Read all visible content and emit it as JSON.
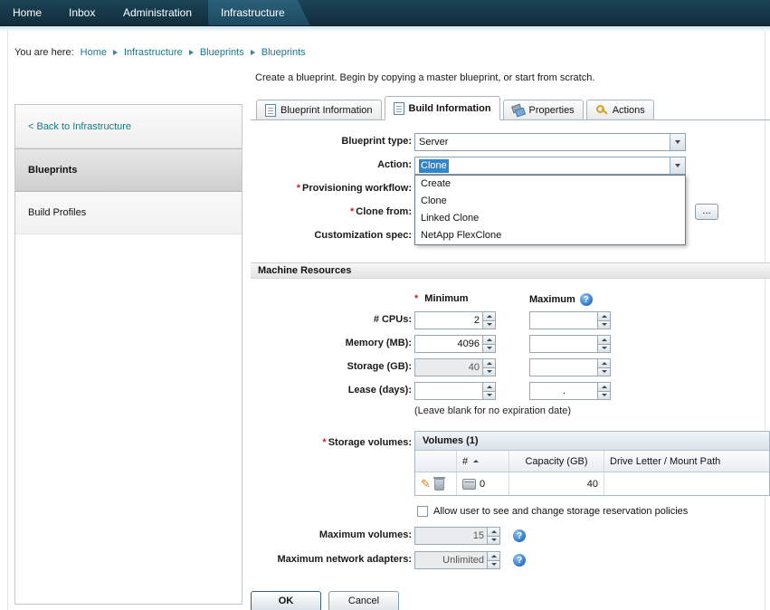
{
  "colors": {
    "topnav_bg": "#15374a",
    "link_teal": "#17788c",
    "selection_blue": "#2f86c8",
    "required_red": "#cc2222",
    "help_blue": "#2a6fc0"
  },
  "icons": {
    "pencil": "✎",
    "help_glyph": "?"
  },
  "topnav": {
    "items": [
      {
        "label": "Home",
        "active": false
      },
      {
        "label": "Inbox",
        "active": false
      },
      {
        "label": "Administration",
        "active": false
      },
      {
        "label": "Infrastructure",
        "active": true
      }
    ]
  },
  "breadcrumb": {
    "prefix": "You are here:",
    "links": [
      "Home",
      "Infrastructure",
      "Blueprints"
    ],
    "current": "Blueprints"
  },
  "intro": "Create a blueprint. Begin by copying a master blueprint, or start from scratch.",
  "sidebar": {
    "back": "< Back to Infrastructure",
    "items": [
      {
        "label": "Blueprints",
        "selected": true
      },
      {
        "label": "Build Profiles",
        "selected": false
      }
    ]
  },
  "tabs": [
    {
      "label": "Blueprint Information",
      "active": false
    },
    {
      "label": "Build Information",
      "active": true
    },
    {
      "label": "Properties",
      "active": false
    },
    {
      "label": "Actions",
      "active": false
    }
  ],
  "form": {
    "blueprint_type": {
      "label": "Blueprint type:",
      "value": "Server"
    },
    "action": {
      "label": "Action:",
      "value": "Clone",
      "options": [
        "Create",
        "Clone",
        "Linked Clone",
        "NetApp FlexClone"
      ]
    },
    "provisioning_workflow": {
      "label": "Provisioning workflow:",
      "required": true
    },
    "clone_from": {
      "label": "Clone from:",
      "required": true,
      "browse_label": "..."
    },
    "customization_spec": {
      "label": "Customization spec:"
    }
  },
  "machine_resources": {
    "title": "Machine Resources",
    "min_header": "Minimum",
    "max_header": "Maximum",
    "rows": [
      {
        "label": "# CPUs:",
        "min": "2",
        "max": ""
      },
      {
        "label": "Memory (MB):",
        "min": "4096",
        "max": ""
      },
      {
        "label": "Storage (GB):",
        "min": "40",
        "max": ""
      },
      {
        "label": "Lease (days):",
        "min": "",
        "max": "."
      }
    ],
    "lease_note": "(Leave blank for no expiration date)",
    "storage_volumes_label": "Storage volumes:",
    "volumes": {
      "title": "Volumes (1)",
      "columns": [
        "#",
        "Capacity (GB)",
        "Drive Letter / Mount Path"
      ],
      "rows": [
        {
          "num": "0",
          "capacity": "40",
          "mount_path": ""
        }
      ]
    },
    "policy_checkbox_label": "Allow user to see and change storage reservation policies",
    "max_volumes": {
      "label": "Maximum volumes:",
      "value": "15"
    },
    "max_network_adapters": {
      "label": "Maximum network adapters:",
      "value": "Unlimited"
    }
  },
  "misc": {
    "required_marker": "*"
  },
  "footer": {
    "ok_label": "OK",
    "cancel_label": "Cancel"
  }
}
